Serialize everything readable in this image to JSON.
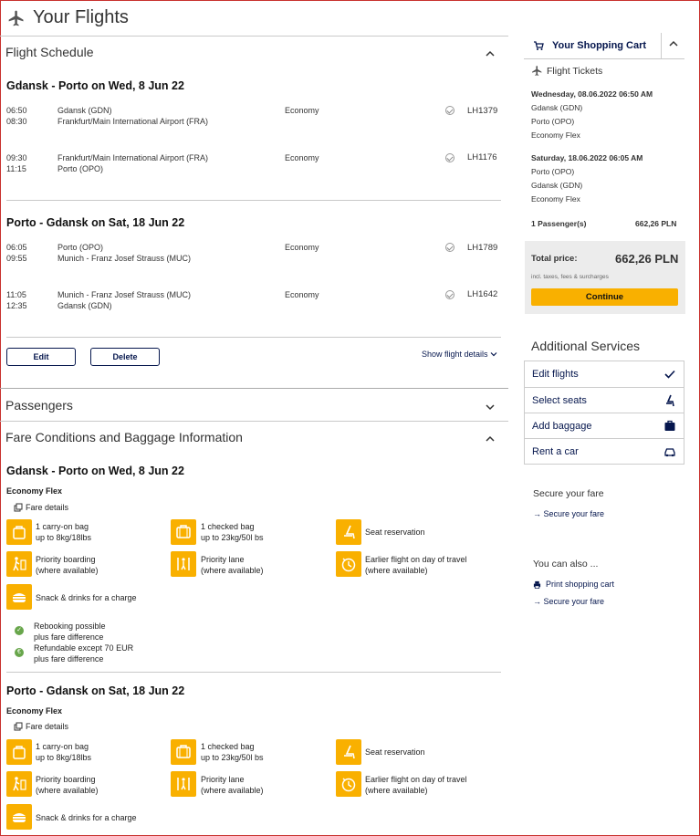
{
  "page_title": "Your Flights",
  "schedule": {
    "title": "Flight Schedule",
    "legs": [
      {
        "route": "Gdansk - Porto on Wed, 8 Jun 22",
        "segments": [
          {
            "dep": "06:50",
            "arr": "08:30",
            "from": "Gdansk (GDN)",
            "to": "Frankfurt/Main International Airport (FRA)",
            "cabin": "Economy",
            "flight": "LH1379"
          },
          {
            "dep": "09:30",
            "arr": "11:15",
            "from": "Frankfurt/Main International Airport (FRA)",
            "to": "Porto (OPO)",
            "cabin": "Economy",
            "flight": "LH1176"
          }
        ]
      },
      {
        "route": "Porto - Gdansk on Sat, 18 Jun 22",
        "segments": [
          {
            "dep": "06:05",
            "arr": "09:55",
            "from": "Porto (OPO)",
            "to": "Munich - Franz Josef Strauss (MUC)",
            "cabin": "Economy",
            "flight": "LH1789"
          },
          {
            "dep": "11:05",
            "arr": "12:35",
            "from": "Munich - Franz Josef Strauss (MUC)",
            "to": "Gdansk (GDN)",
            "cabin": "Economy",
            "flight": "LH1642"
          }
        ]
      }
    ],
    "edit_label": "Edit",
    "delete_label": "Delete",
    "show_details_label": "Show flight details"
  },
  "passengers": {
    "title": "Passengers"
  },
  "fare": {
    "title": "Fare Conditions and Baggage Information",
    "details_label": "Fare details",
    "blocks": [
      {
        "route": "Gdansk - Porto on Wed, 8 Jun 22",
        "fare_name": "Economy Flex",
        "features": [
          {
            "l1": "1 carry-on bag",
            "l2": "up to 8kg/18lbs"
          },
          {
            "l1": "1 checked bag",
            "l2": "up to 23kg/50l bs"
          },
          {
            "l1": "Seat reservation",
            "l2": ""
          },
          {
            "l1": "Priority boarding",
            "l2": "(where available)"
          },
          {
            "l1": "Priority lane",
            "l2": "(where available)"
          },
          {
            "l1": "Earlier flight on day of travel",
            "l2": "(where available)"
          },
          {
            "l1": "Snack & drinks for a charge",
            "l2": ""
          }
        ],
        "conditions": [
          {
            "l1": "Rebooking possible",
            "l2": "plus fare difference",
            "symbol": "✓"
          },
          {
            "l1": "Refundable except 70 EUR",
            "l2": "plus fare difference",
            "symbol": "€"
          }
        ]
      },
      {
        "route": "Porto - Gdansk on Sat, 18 Jun 22",
        "fare_name": "Economy Flex",
        "features": [
          {
            "l1": "1 carry-on bag",
            "l2": "up to 8kg/18lbs"
          },
          {
            "l1": "1 checked bag",
            "l2": "up to 23kg/50l bs"
          },
          {
            "l1": "Seat reservation",
            "l2": ""
          },
          {
            "l1": "Priority boarding",
            "l2": "(where available)"
          },
          {
            "l1": "Priority lane",
            "l2": "(where available)"
          },
          {
            "l1": "Earlier flight on day of travel",
            "l2": "(where available)"
          },
          {
            "l1": "Snack & drinks for a charge",
            "l2": ""
          }
        ]
      }
    ]
  },
  "cart": {
    "title": "Your Shopping Cart",
    "tickets_label": "Flight Tickets",
    "outbound": {
      "date": "Wednesday, 08.06.2022 06:50 AM",
      "from": "Gdansk (GDN)",
      "to": "Porto (OPO)",
      "fare": "Economy Flex"
    },
    "inbound": {
      "date": "Saturday, 18.06.2022 06:05 AM",
      "from": "Porto (OPO)",
      "to": "Gdansk (GDN)",
      "fare": "Economy Flex"
    },
    "passengers_label": "1 Passenger(s)",
    "passengers_price": "662,26 PLN",
    "total_label": "Total price:",
    "total_value": "662,26 PLN",
    "taxes_note": "incl. taxes, fees & surcharges",
    "continue_label": "Continue"
  },
  "additional_services": {
    "title": "Additional Services",
    "items": [
      "Edit flights",
      "Select seats",
      "Add baggage",
      "Rent a car"
    ]
  },
  "secure": {
    "title": "Secure your fare",
    "link": "Secure your fare"
  },
  "also": {
    "title": "You can also ...",
    "print": "Print shopping cart",
    "secure": "Secure your fare"
  },
  "colors": {
    "accent": "#f9b000",
    "navy": "#05164d",
    "frame": "#c8312e"
  }
}
